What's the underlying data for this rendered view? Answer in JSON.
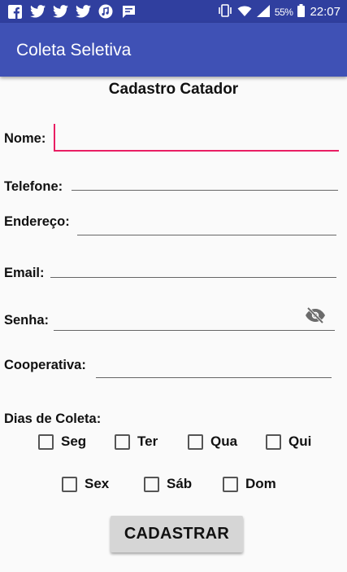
{
  "status_bar": {
    "left_icons": [
      "facebook-icon",
      "twitter-icon",
      "twitter-icon",
      "twitter-icon",
      "music-icon",
      "message-icon"
    ],
    "battery": "55%",
    "time": "22:07"
  },
  "app_bar": {
    "title": "Coleta Seletiva"
  },
  "form": {
    "title": "Cadastro Catador",
    "fields": {
      "nome": {
        "label": "Nome:",
        "value": ""
      },
      "telefone": {
        "label": "Telefone:",
        "value": ""
      },
      "endereco": {
        "label": "Endereço:",
        "value": ""
      },
      "email": {
        "label": "Email:",
        "value": ""
      },
      "senha": {
        "label": "Senha:",
        "value": ""
      },
      "cooperativa": {
        "label": "Cooperativa:",
        "value": ""
      }
    },
    "dias_label": "Dias de Coleta:",
    "dias": [
      "Seg",
      "Ter",
      "Qua",
      "Qui",
      "Sex",
      "Sáb",
      "Dom"
    ],
    "submit_label": "CADASTRAR"
  },
  "colors": {
    "accent": "#e91e63",
    "primary": "#3f51b5",
    "primary_dark": "#303f9f"
  }
}
